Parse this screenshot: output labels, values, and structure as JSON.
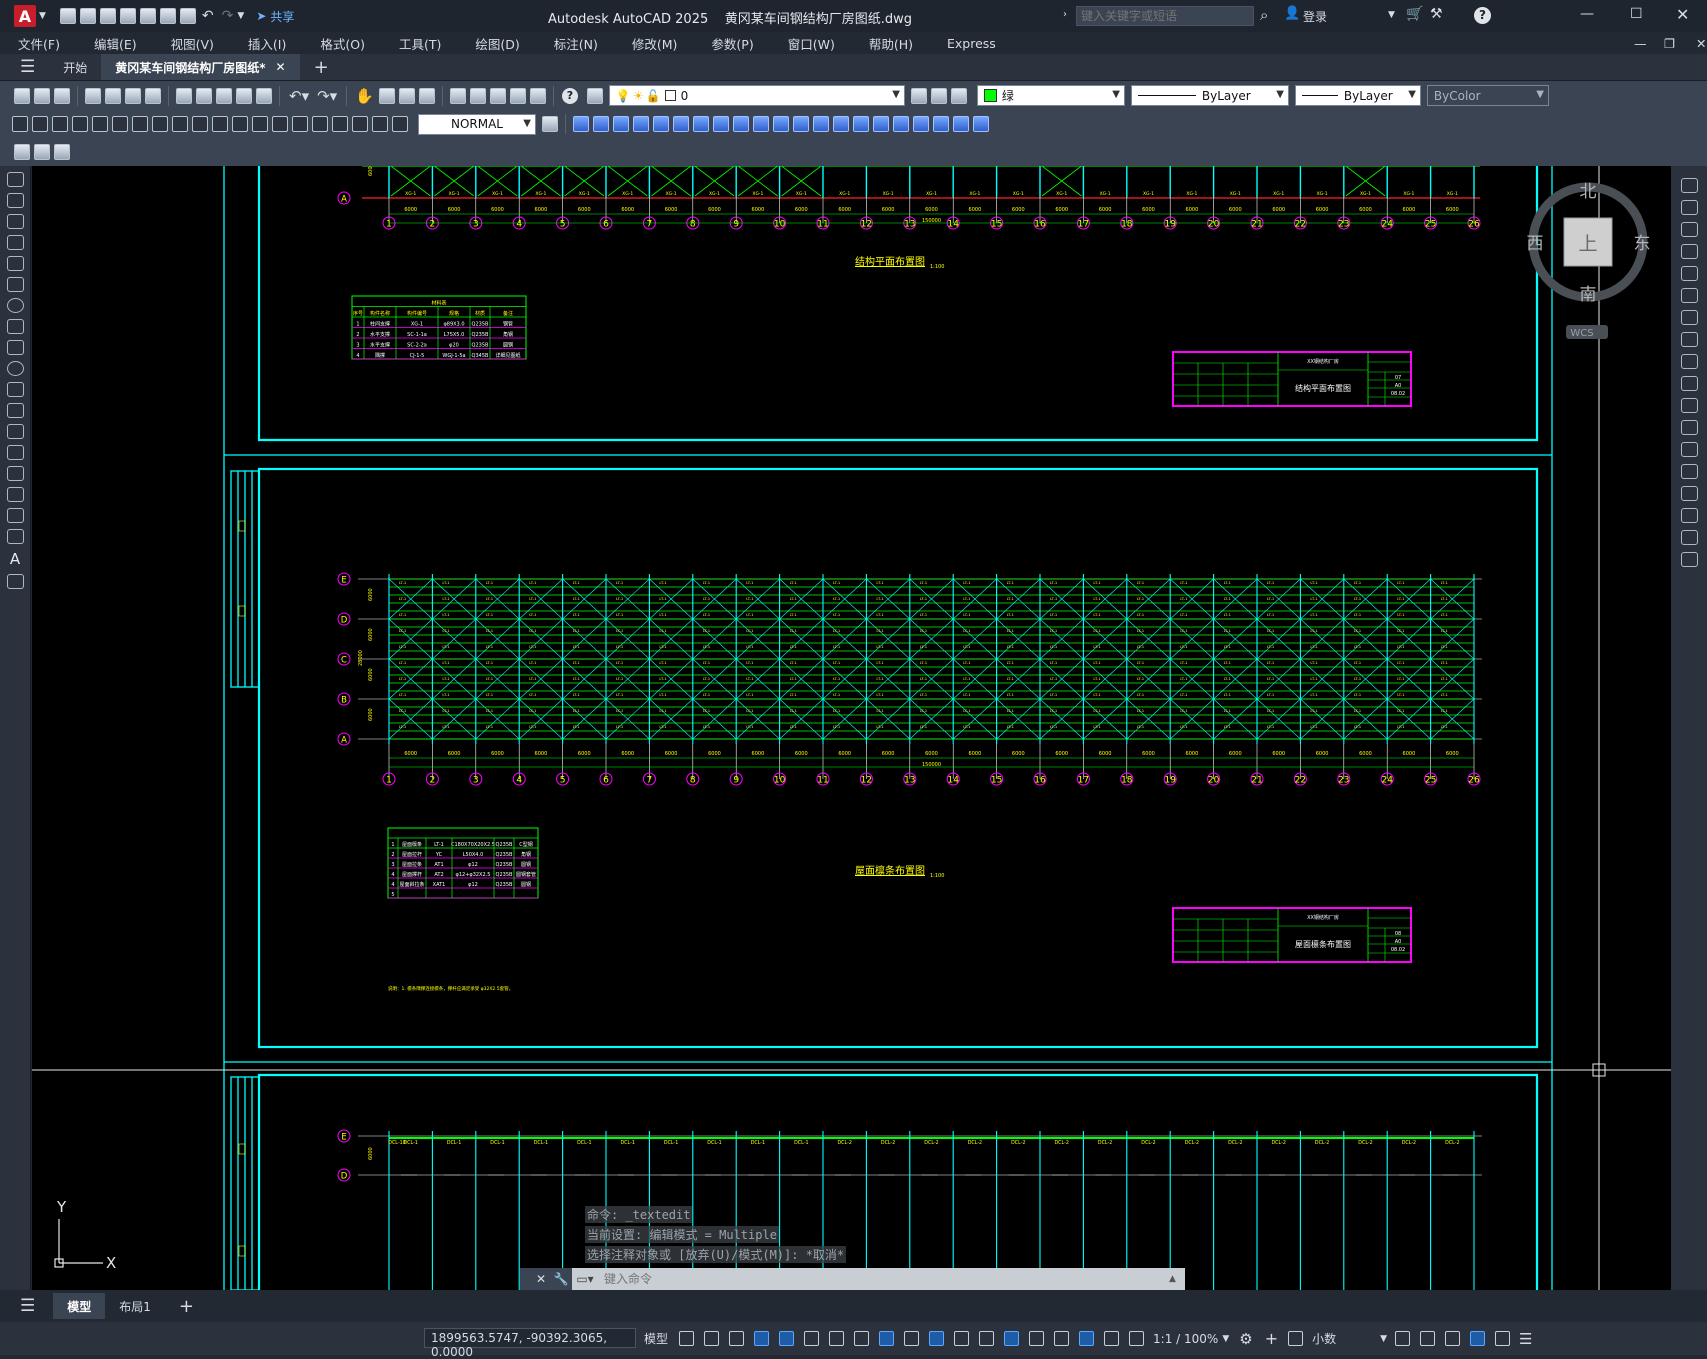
{
  "titlebar": {
    "app_logo": "A",
    "share": "共享",
    "title": "Autodesk AutoCAD 2025    黄冈某车间钢结构厂房图纸.dwg",
    "search_placeholder": "键入关键字或短语",
    "login": "登录"
  },
  "menubar": [
    "文件(F)",
    "编辑(E)",
    "视图(V)",
    "插入(I)",
    "格式(O)",
    "工具(T)",
    "绘图(D)",
    "标注(N)",
    "修改(M)",
    "参数(P)",
    "窗口(W)",
    "帮助(H)",
    "Express"
  ],
  "filetabs": {
    "start": "开始",
    "active": "黄冈某车间钢结构厂房图纸*"
  },
  "toolbar": {
    "layer": "0",
    "color": "绿",
    "linetype": "ByLayer",
    "lineweight": "ByLayer",
    "plotstyle": "ByColor",
    "dimstyle": "NORMAL",
    "accent_green": "#00ff00"
  },
  "viewcube": {
    "north": "北",
    "south": "南",
    "east": "东",
    "west": "西",
    "top": "上",
    "wcs": "WCS"
  },
  "drawing": {
    "axis_numbers": [
      "1",
      "2",
      "3",
      "4",
      "5",
      "6",
      "7",
      "8",
      "9",
      "10",
      "11",
      "12",
      "13",
      "14",
      "15",
      "16",
      "17",
      "18",
      "19",
      "20",
      "21",
      "22",
      "23",
      "24",
      "25",
      "26"
    ],
    "axis_letters": [
      "E",
      "D",
      "C",
      "B",
      "A"
    ],
    "dim_span": "6000",
    "total_length": "150000",
    "total_width": "28000",
    "plan1_title": "结构平面布置图",
    "plan1_scale": "1:100",
    "plan2_title": "屋面檩条布置图",
    "plan2_scale": "1:100",
    "plan3_title": "屋面檩条布置图",
    "table1_title": "材料表",
    "table1_header": [
      "序号",
      "构件名称",
      "构件编号",
      "规格",
      "材质",
      "备注"
    ],
    "table1_rows": [
      [
        "1",
        "柱间支撑",
        "XG-1",
        "φ89X3.0",
        "Q235B",
        "钢管"
      ],
      [
        "2",
        "水平支撑",
        "SC-1-1a",
        "L75X5.0",
        "Q235B",
        "角钢"
      ],
      [
        "3",
        "水平支撑",
        "SC-2-2a",
        "φ20",
        "Q235B",
        "圆钢"
      ],
      [
        "4",
        "隅撑",
        "CJ-1-5",
        "WGJ-1-5a",
        "Q345B",
        "详细见图纸"
      ]
    ],
    "table2_rows": [
      [
        "1",
        "屋面檩条",
        "LT-1",
        "C180X70X20X2.5",
        "Q235B",
        "C型钢"
      ],
      [
        "2",
        "屋面拉杆",
        "YC",
        "L50X4.0",
        "Q235B",
        "角钢"
      ],
      [
        "3",
        "屋面拉条",
        "AT1",
        "φ12",
        "Q235B",
        "圆钢"
      ],
      [
        "4",
        "屋面撑杆",
        "AT2",
        "φ12+φ32X2.5",
        "Q235B",
        "圆钢套管"
      ],
      [
        "4",
        "屋面斜拉条",
        "XAT1",
        "φ12",
        "Q235B",
        "圆钢"
      ],
      [
        "5",
        "",
        "",
        "",
        "",
        ""
      ]
    ],
    "table2_note": "说明：1. 檩条隅撑连接檩条，撑杆应满足承受 φ32X2.5套管。",
    "titleblock1_company": "XX钢结构厂房",
    "titleblock1_name": "结构平面布置图",
    "titleblock1_no": "07",
    "titleblock2_company": "XX钢结构厂房",
    "titleblock2_name": "屋面檩条布置图",
    "titleblock2_no": "08",
    "sheet_size": "A0",
    "date": "08.02",
    "beam_labels": [
      "XG-1",
      "DCL-1",
      "DCL-2",
      "DCL-10"
    ]
  },
  "command": {
    "history": [
      "命令: _textedit",
      "当前设置: 编辑模式 = Multiple",
      "选择注释对象或 [放弃(U)/模式(M)]: *取消*"
    ],
    "placeholder": "键入命令"
  },
  "layouttabs": {
    "model": "模型",
    "layout1": "布局1"
  },
  "status": {
    "coords": "1899563.5747, -90392.3065, 0.0000",
    "space": "模型",
    "scale": "1:1 / 100%",
    "units": "小数"
  },
  "ucs": {
    "x": "X",
    "y": "Y"
  }
}
